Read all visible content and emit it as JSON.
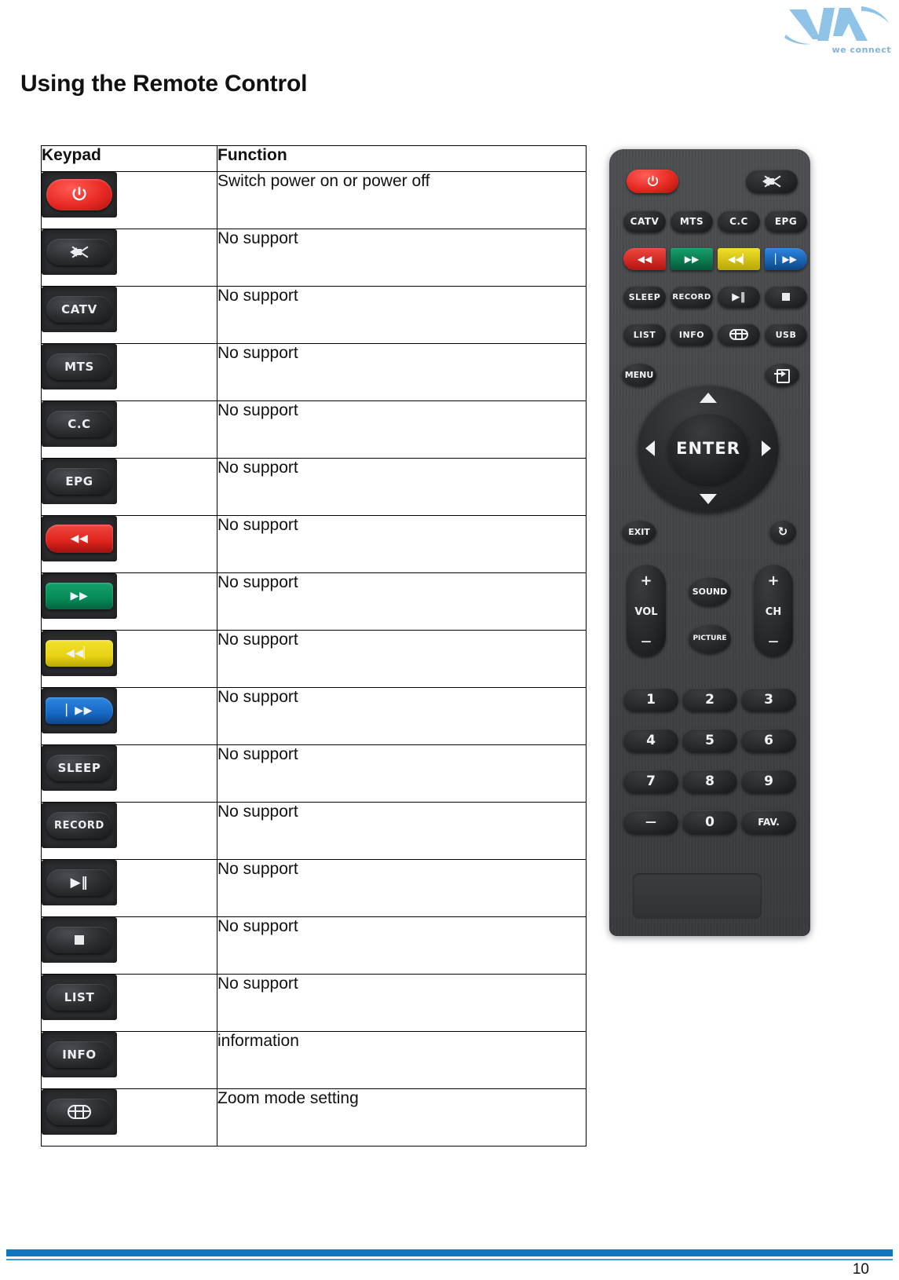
{
  "brand": {
    "logo_name": "via-logo",
    "tagline": "we connect",
    "logo_color": "#8fc4e8"
  },
  "page": {
    "title": "Using the Remote Control",
    "number": "10",
    "footer_color": "#1076bd"
  },
  "table": {
    "headers": {
      "keypad": "Keypad",
      "function": "Function"
    },
    "rows": [
      {
        "key": "power",
        "icon": "power-icon",
        "label": "",
        "function": "Switch power on or power off"
      },
      {
        "key": "mute",
        "icon": "mute-icon",
        "label": "",
        "function": "No support"
      },
      {
        "key": "catv",
        "icon": "catv-button",
        "label": "CATV",
        "function": "No support"
      },
      {
        "key": "mts",
        "icon": "mts-button",
        "label": "MTS",
        "function": "No support"
      },
      {
        "key": "cc",
        "icon": "cc-button",
        "label": "C.C",
        "function": "No support"
      },
      {
        "key": "epg",
        "icon": "epg-button",
        "label": "EPG",
        "function": "No support"
      },
      {
        "key": "rewind",
        "icon": "rewind-icon",
        "label": "◀◀",
        "function": "No support"
      },
      {
        "key": "fastforward",
        "icon": "fast-forward-icon",
        "label": "▶▶",
        "function": "No support"
      },
      {
        "key": "previous",
        "icon": "previous-track-icon",
        "label": "◀◀▏",
        "function": "No support"
      },
      {
        "key": "next",
        "icon": "next-track-icon",
        "label": "▏▶▶",
        "function": "No support"
      },
      {
        "key": "sleep",
        "icon": "sleep-button",
        "label": "SLEEP",
        "function": "No support"
      },
      {
        "key": "record",
        "icon": "record-button",
        "label": "RECORD",
        "function": "No support"
      },
      {
        "key": "playpause",
        "icon": "play-pause-icon",
        "label": "▶‖",
        "function": "No support"
      },
      {
        "key": "stop",
        "icon": "stop-icon",
        "label": "",
        "function": "No support"
      },
      {
        "key": "list",
        "icon": "list-button",
        "label": "LIST",
        "function": "No support"
      },
      {
        "key": "info",
        "icon": "info-button",
        "label": "INFO",
        "function": "information"
      },
      {
        "key": "zoom",
        "icon": "zoom-grid-icon",
        "label": "",
        "function": "Zoom mode setting"
      }
    ]
  },
  "remote": {
    "name": "remote-control-photo",
    "power": "",
    "mute": "",
    "row_catv": [
      "CATV",
      "MTS",
      "C.C",
      "EPG"
    ],
    "row_colors": [
      "◀◀",
      "▶▶",
      "◀◀▏",
      "▏▶▶"
    ],
    "row_colors_hex": [
      "#dd231c",
      "#058a57",
      "#e8d313",
      "#1668c4"
    ],
    "row_sleep": [
      "SLEEP",
      "RECORD",
      "▶‖",
      ""
    ],
    "row_list": [
      "LIST",
      "INFO",
      "",
      "USB"
    ],
    "menu": "MENU",
    "source": "",
    "enter": "ENTER",
    "exit": "EXIT",
    "return": "↻",
    "vol_plus": "+",
    "vol_label": "VOL",
    "vol_minus": "—",
    "ch_plus": "+",
    "ch_label": "CH",
    "ch_minus": "—",
    "sound": "SOUND",
    "picture": "PICTURE",
    "numbers": [
      "1",
      "2",
      "3",
      "4",
      "5",
      "6",
      "7",
      "8",
      "9"
    ],
    "bottom_row": [
      "—",
      "0",
      "FAV."
    ]
  }
}
